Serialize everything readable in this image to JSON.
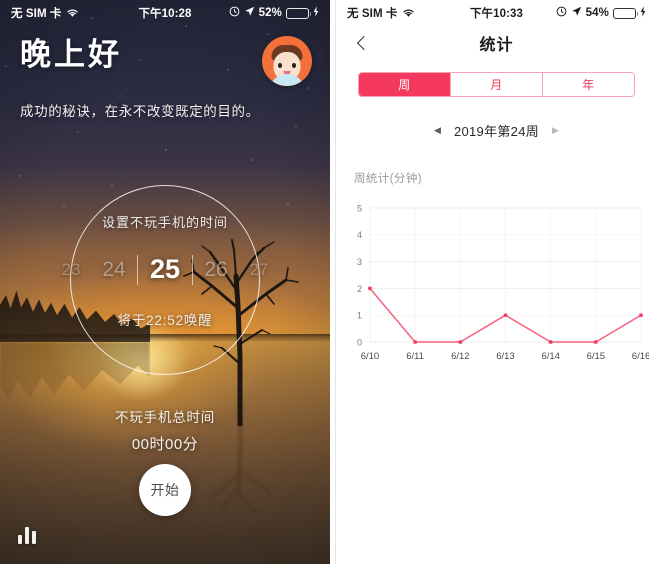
{
  "left_phone": {
    "status_bar": {
      "carrier": "无 SIM 卡",
      "wifi_icon": "wifi-icon",
      "time": "下午10:28",
      "alarm_icon": "alarm-clock-icon",
      "location_icon": "location-arrow-icon",
      "battery_percent": "52%",
      "battery_level": 52,
      "charging_icon": "lightning-bolt-icon"
    },
    "greeting": {
      "title": "晚上好",
      "subtitle": "成功的秘诀，在永不改变既定的目的。",
      "avatar_name": "avatar"
    },
    "dial": {
      "hint": "设置不玩手机的时间",
      "picker_values": [
        "23",
        "24",
        "25",
        "26",
        "27"
      ],
      "selected_index": 2,
      "wake_text": "将于22:52唤醒"
    },
    "total": {
      "label": "不玩手机总时间",
      "value": "00时00分"
    },
    "start_button": "开始",
    "stats_icon": "bar-chart-icon"
  },
  "right_phone": {
    "status_bar": {
      "carrier": "无 SIM 卡",
      "wifi_icon": "wifi-icon",
      "time": "下午10:33",
      "alarm_icon": "alarm-clock-icon",
      "location_icon": "location-arrow-icon",
      "battery_percent": "54%",
      "battery_level": 54,
      "charging_icon": "lightning-bolt-icon"
    },
    "nav": {
      "back_icon": "chevron-left-icon",
      "title": "统计"
    },
    "segments": [
      {
        "label": "周",
        "active": true
      },
      {
        "label": "月",
        "active": false
      },
      {
        "label": "年",
        "active": false
      }
    ],
    "week_nav": {
      "prev_icon": "triangle-left-icon",
      "label": "2019年第24周",
      "next_icon": "triangle-right-icon"
    },
    "accent_color": "#F5395E",
    "muted_color": "#9B9B9B"
  },
  "chart_data": {
    "type": "line",
    "title": "周统计(分钟)",
    "xlabel": "",
    "ylabel": "",
    "categories": [
      "6/10",
      "6/11",
      "6/12",
      "6/13",
      "6/14",
      "6/15",
      "6/16"
    ],
    "values": [
      2,
      0,
      0,
      1,
      0,
      0,
      1
    ],
    "yticks": [
      0,
      1,
      2,
      3,
      4,
      5
    ],
    "ylim": [
      0,
      5
    ],
    "grid": true,
    "legend": false,
    "line_color": "#F5617E",
    "marker_color": "#F5395E"
  }
}
